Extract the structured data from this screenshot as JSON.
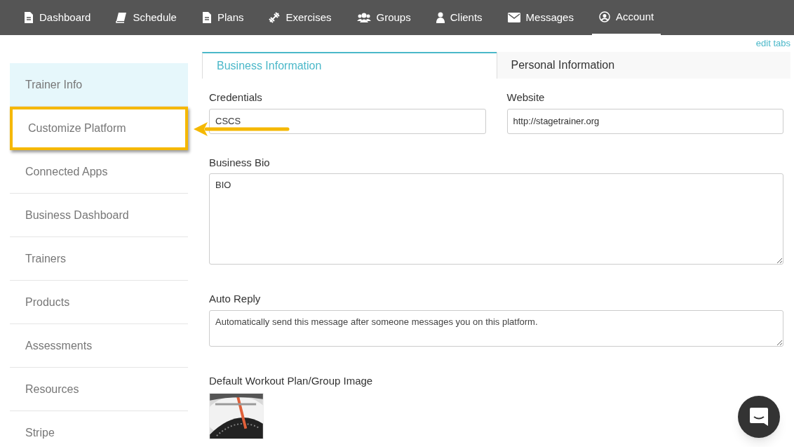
{
  "nav": [
    {
      "label": "Dashboard",
      "kind": "doc",
      "selected": false
    },
    {
      "label": "Schedule",
      "kind": "book",
      "selected": false
    },
    {
      "label": "Plans",
      "kind": "doc",
      "selected": false
    },
    {
      "label": "Exercises",
      "kind": "dumbbell",
      "selected": false
    },
    {
      "label": "Groups",
      "kind": "group",
      "selected": false
    },
    {
      "label": "Clients",
      "kind": "person",
      "selected": false
    },
    {
      "label": "Messages",
      "kind": "envelope",
      "selected": false
    },
    {
      "label": "Account",
      "kind": "account",
      "selected": true
    }
  ],
  "edit_tabs": "edit tabs",
  "sidebar": {
    "items": [
      {
        "label": "Trainer Info",
        "selected": true,
        "highlighted": false
      },
      {
        "label": "Customize Platform",
        "selected": false,
        "highlighted": true
      },
      {
        "label": "Connected Apps",
        "selected": false,
        "highlighted": false
      },
      {
        "label": "Business Dashboard",
        "selected": false,
        "highlighted": false
      },
      {
        "label": "Trainers",
        "selected": false,
        "highlighted": false
      },
      {
        "label": "Products",
        "selected": false,
        "highlighted": false
      },
      {
        "label": "Assessments",
        "selected": false,
        "highlighted": false
      },
      {
        "label": "Resources",
        "selected": false,
        "highlighted": false
      },
      {
        "label": "Stripe",
        "selected": false,
        "highlighted": false
      }
    ]
  },
  "tabs": [
    {
      "label": "Business Information",
      "selected": true
    },
    {
      "label": "Personal Information",
      "selected": false
    }
  ],
  "form": {
    "credentials": {
      "label": "Credentials",
      "value": "CSCS"
    },
    "website": {
      "label": "Website",
      "value": "http://stagetrainer.org"
    },
    "bio": {
      "label": "Business Bio",
      "value": "BIO"
    },
    "auto_reply": {
      "label": "Auto Reply",
      "placeholder": "Automatically send this message after someone messages you on this platform."
    },
    "image": {
      "label": "Default Workout Plan/Group Image",
      "kind": "picture"
    }
  }
}
